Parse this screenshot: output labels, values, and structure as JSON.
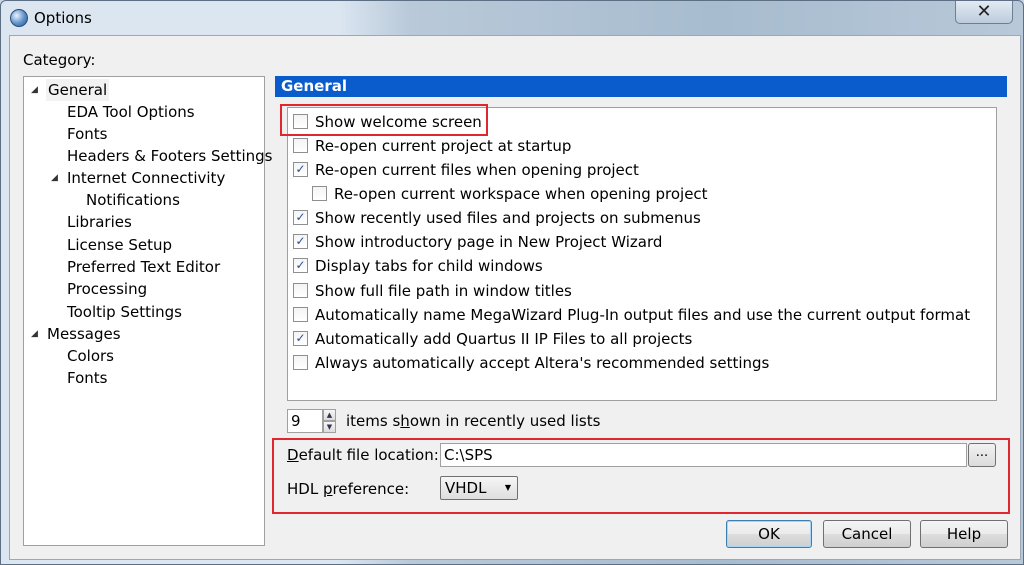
{
  "window": {
    "title": "Options",
    "close_glyph": "✕"
  },
  "category_label": "Category:",
  "tree": {
    "items": [
      {
        "label": "General",
        "arrow": "◢"
      },
      {
        "label": "EDA Tool Options"
      },
      {
        "label": "Fonts"
      },
      {
        "label": "Headers & Footers Settings"
      },
      {
        "label": "Internet Connectivity",
        "arrow": "◢"
      },
      {
        "label": "Notifications"
      },
      {
        "label": "Libraries"
      },
      {
        "label": "License Setup"
      },
      {
        "label": "Preferred Text Editor"
      },
      {
        "label": "Processing"
      },
      {
        "label": "Tooltip Settings"
      },
      {
        "label": "Messages",
        "arrow": "◢"
      },
      {
        "label": "Colors"
      },
      {
        "label": "Fonts"
      }
    ]
  },
  "panel": {
    "header": "General",
    "checkboxes": [
      {
        "label": "Show welcome screen",
        "checked": false
      },
      {
        "label": "Re-open current project at startup",
        "checked": false
      },
      {
        "label": "Re-open current files when opening project",
        "checked": true
      },
      {
        "label": "Re-open current workspace when opening project",
        "checked": false
      },
      {
        "label": "Show recently used files and projects on submenus",
        "checked": true
      },
      {
        "label": "Show introductory page in New Project Wizard",
        "checked": true
      },
      {
        "label": "Display tabs for child windows",
        "checked": true
      },
      {
        "label": "Show full file path in window titles",
        "checked": false
      },
      {
        "label": "Automatically name MegaWizard Plug-In output files and use the current output format",
        "checked": false
      },
      {
        "label": "Automatically add Quartus II IP Files to all projects",
        "checked": true
      },
      {
        "label": "Always automatically accept Altera's recommended settings",
        "checked": false
      }
    ],
    "check_glyph": "✓",
    "recent_items": {
      "value": "9",
      "label_pre": "items s",
      "label_accel": "h",
      "label_post": "own in recently used lists"
    },
    "default_location": {
      "label_accel": "D",
      "label_post": "efault file location:",
      "value": "C:\\SPS",
      "browse_label": "..."
    },
    "hdl_preference": {
      "label_pre": "HDL ",
      "label_accel": "p",
      "label_post": "reference:",
      "value": "VHDL",
      "arrow": "▼"
    }
  },
  "buttons": {
    "ok": "OK",
    "cancel": "Cancel",
    "help": "Help"
  },
  "colors": {
    "header_blue": "#0a5ccc",
    "highlight_red": "#e0272f"
  }
}
